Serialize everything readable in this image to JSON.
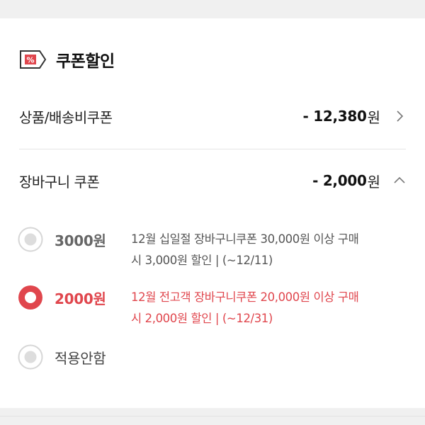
{
  "section": {
    "title": "쿠폰할인",
    "icon": "coupon-percent-icon"
  },
  "product_coupon": {
    "label": "상품/배송비쿠폰",
    "amount": "- 12,380",
    "unit": "원",
    "icon": "chevron-right-icon"
  },
  "cart_coupon": {
    "label": "장바구니 쿠폰",
    "amount": "- 2,000",
    "unit": "원",
    "icon": "chevron-up-icon"
  },
  "options": [
    {
      "label": "3000원",
      "desc_line1": "12월 십일절 장바구니쿠폰 30,000원 이상 구매",
      "desc_line2": "시 3,000원 할인 | (~12/11)",
      "selected": false
    },
    {
      "label": "2000원",
      "desc_line1": "12월 전고객 장바구니쿠폰 20,000원 이상 구매",
      "desc_line2": "시 2,000원 할인 | (~12/31)",
      "selected": true
    },
    {
      "label": "적용안함",
      "selected": false
    }
  ],
  "colors": {
    "accent": "#e0464d",
    "text": "#222222",
    "muted": "#666666",
    "divider": "#e6e6e6",
    "background_band": "#f0f0f0"
  }
}
